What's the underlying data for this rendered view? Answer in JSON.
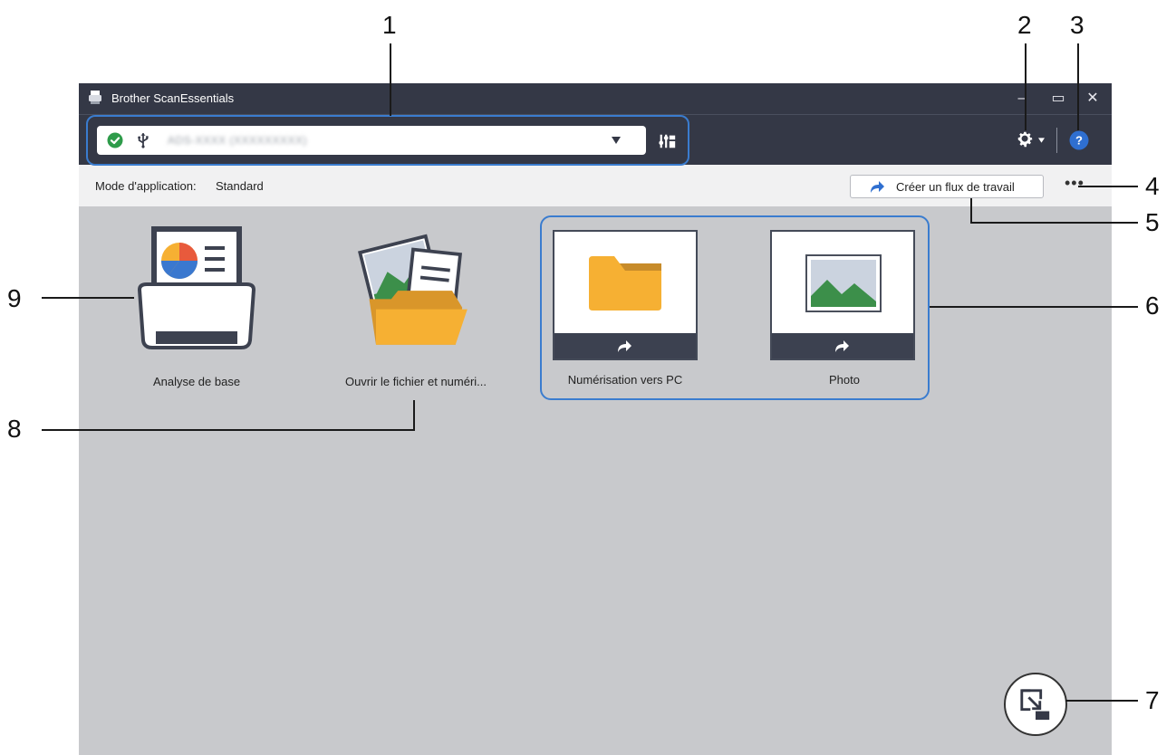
{
  "window": {
    "title": "Brother ScanEssentials",
    "controls": {
      "minimize": "–",
      "maximize": "▭",
      "close": "✕"
    }
  },
  "toolbar": {
    "device_name": "ADS-XXXX (XXXXXXXXX)",
    "status_icon": "check-circle-icon",
    "connection_icon": "usb-icon",
    "device_settings_icon": "device-settings-icon",
    "settings_icon": "gear-icon",
    "help_icon": "help-icon"
  },
  "modebar": {
    "label": "Mode d'application:",
    "value": "Standard",
    "create_workflow": "Créer un flux de travail",
    "more": "•••"
  },
  "tiles": {
    "basic_scan": "Analyse de base",
    "open_file": "Ouvrir le fichier et numéri...",
    "scan_to_pc": "Numérisation vers PC",
    "photo": "Photo"
  },
  "callouts": [
    "1",
    "2",
    "3",
    "4",
    "5",
    "6",
    "7",
    "8",
    "9"
  ],
  "colors": {
    "titlebar": "#343846",
    "accent_blue": "#3a7ccf",
    "folder_yellow": "#f6b033",
    "canvas": "#c8c9cc"
  }
}
